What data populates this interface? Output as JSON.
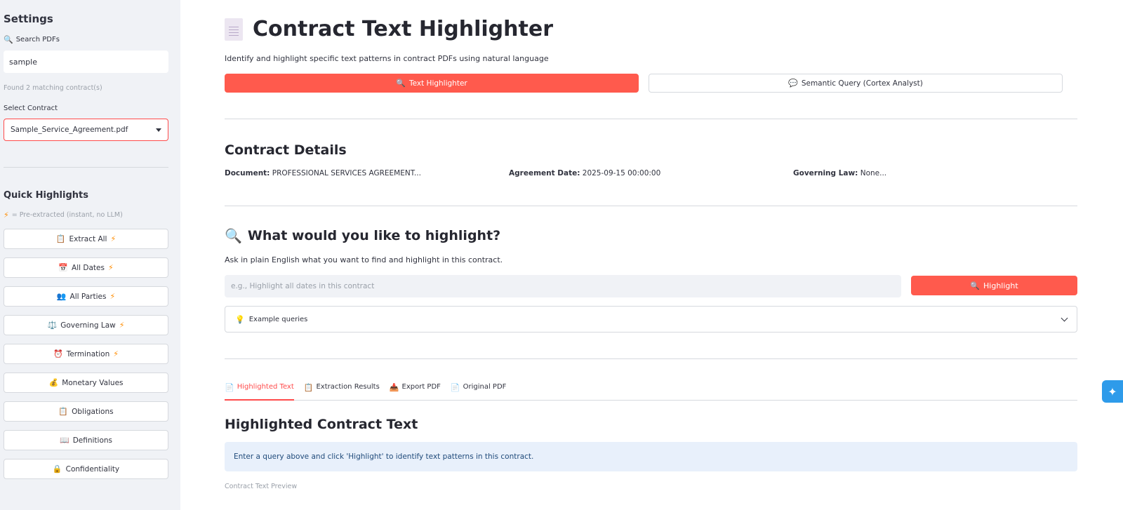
{
  "sidebar": {
    "title": "Settings",
    "search": {
      "icon": "🔍",
      "label": "Search PDFs",
      "value": "sample",
      "result": "Found 2 matching contract(s)"
    },
    "select": {
      "label": "Select Contract",
      "value": "Sample_Service_Agreement.pdf"
    },
    "quick": {
      "title": "Quick Highlights",
      "note": "= Pre-extracted (instant, no LLM)",
      "items": [
        {
          "icon": "📋",
          "label": "Extract All",
          "bolt": "⚡"
        },
        {
          "icon": "📅",
          "label": "All Dates",
          "bolt": "⚡"
        },
        {
          "icon": "👥",
          "label": "All Parties",
          "bolt": "⚡"
        },
        {
          "icon": "⚖️",
          "label": "Governing Law",
          "bolt": "⚡"
        },
        {
          "icon": "⏰",
          "label": "Termination",
          "bolt": "⚡"
        },
        {
          "icon": "💰",
          "label": "Monetary Values",
          "bolt": ""
        },
        {
          "icon": "📋",
          "label": "Obligations",
          "bolt": ""
        },
        {
          "icon": "📖",
          "label": "Definitions",
          "bolt": ""
        },
        {
          "icon": "🔒",
          "label": "Confidentiality",
          "bolt": ""
        }
      ]
    }
  },
  "main": {
    "title": "Contract Text Highlighter",
    "subtitle": "Identify and highlight specific text patterns in contract PDFs using natural language",
    "modes": [
      {
        "icon": "🔍",
        "label": "Text Highlighter"
      },
      {
        "icon": "💬",
        "label": "Semantic Query (Cortex Analyst)"
      }
    ],
    "details": {
      "heading": "Contract Details",
      "document_label": "Document:",
      "document_value": "PROFESSIONAL SERVICES AGREEMENT...",
      "date_label": "Agreement Date:",
      "date_value": "2025-09-15 00:00:00",
      "law_label": "Governing Law:",
      "law_value": "None..."
    },
    "highlight": {
      "icon": "🔍",
      "heading": "What would you like to highlight?",
      "ask": "Ask in plain English what you want to find and highlight in this contract.",
      "placeholder": "e.g., Highlight all dates in this contract",
      "button_icon": "🔍",
      "button": "Highlight",
      "expander_icon": "💡",
      "expander": "Example queries"
    },
    "tabs": [
      {
        "icon": "📄",
        "label": "Highlighted Text"
      },
      {
        "icon": "📋",
        "label": "Extraction Results"
      },
      {
        "icon": "📥",
        "label": "Export PDF"
      },
      {
        "icon": "📄",
        "label": "Original PDF"
      }
    ],
    "result": {
      "heading": "Highlighted Contract Text",
      "info": "Enter a query above and click 'Highlight' to identify text patterns in this contract.",
      "preview": "Contract Text Preview"
    }
  },
  "fab": {
    "icon": "✦"
  }
}
